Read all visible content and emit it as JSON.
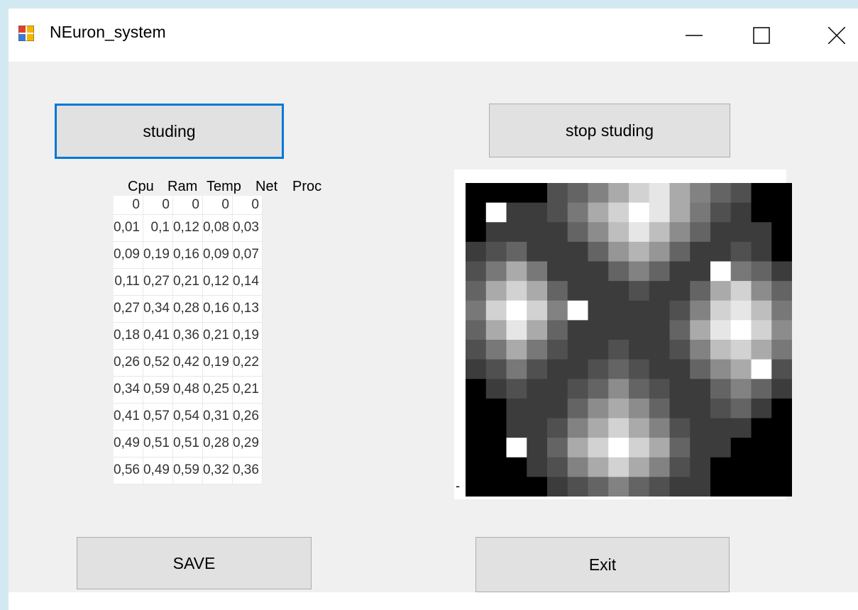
{
  "window": {
    "title": "NEuron_system",
    "controls": {
      "minimize": "minimize-icon",
      "maximize": "maximize-icon",
      "close": "close-icon"
    }
  },
  "buttons": {
    "studing": "studing",
    "stop_studing": "stop studing",
    "save": "SAVE",
    "exit": "Exit"
  },
  "grid": {
    "columns": [
      "Cpu",
      "Ram",
      "Temp",
      "Net",
      "Proc"
    ],
    "rows": [
      [
        "0",
        "0",
        "0",
        "0",
        "0"
      ],
      [
        "0,01",
        "0,1",
        "0,12",
        "0,08",
        "0,03"
      ],
      [
        "0,09",
        "0,19",
        "0,16",
        "0,09",
        "0,07"
      ],
      [
        "0,11",
        "0,27",
        "0,21",
        "0,12",
        "0,14"
      ],
      [
        "0,27",
        "0,34",
        "0,28",
        "0,16",
        "0,13"
      ],
      [
        "0,18",
        "0,41",
        "0,36",
        "0,21",
        "0,19"
      ],
      [
        "0,26",
        "0,52",
        "0,42",
        "0,19",
        "0,22"
      ],
      [
        "0,34",
        "0,59",
        "0,48",
        "0,25",
        "0,21"
      ],
      [
        "0,41",
        "0,57",
        "0,54",
        "0,31",
        "0,26"
      ],
      [
        "0,49",
        "0,51",
        "0,51",
        "0,28",
        "0,29"
      ],
      [
        "0,56",
        "0,49",
        "0,59",
        "0,32",
        "0,36"
      ]
    ]
  },
  "image_panel": {
    "side_mark": "-",
    "grid_size": 16,
    "cells": [
      [
        0,
        0,
        0,
        0,
        80,
        100,
        130,
        170,
        210,
        230,
        170,
        130,
        100,
        80,
        0,
        0
      ],
      [
        0,
        255,
        60,
        60,
        80,
        120,
        170,
        210,
        255,
        230,
        170,
        120,
        80,
        60,
        0,
        0
      ],
      [
        0,
        60,
        60,
        60,
        60,
        100,
        140,
        190,
        230,
        190,
        140,
        100,
        60,
        60,
        60,
        0
      ],
      [
        60,
        80,
        100,
        60,
        60,
        60,
        100,
        150,
        180,
        150,
        100,
        60,
        60,
        80,
        60,
        0
      ],
      [
        80,
        120,
        170,
        120,
        60,
        60,
        60,
        100,
        130,
        100,
        60,
        60,
        255,
        120,
        100,
        60
      ],
      [
        100,
        170,
        210,
        170,
        100,
        60,
        60,
        60,
        80,
        60,
        60,
        100,
        170,
        210,
        140,
        100
      ],
      [
        120,
        210,
        255,
        210,
        130,
        255,
        60,
        60,
        60,
        60,
        80,
        130,
        210,
        230,
        190,
        120
      ],
      [
        100,
        170,
        230,
        170,
        100,
        60,
        60,
        60,
        60,
        60,
        100,
        170,
        230,
        255,
        210,
        140
      ],
      [
        80,
        120,
        170,
        120,
        80,
        60,
        60,
        80,
        60,
        60,
        80,
        130,
        190,
        210,
        170,
        120
      ],
      [
        60,
        80,
        120,
        80,
        60,
        60,
        80,
        100,
        80,
        60,
        60,
        100,
        140,
        170,
        255,
        80
      ],
      [
        0,
        60,
        80,
        60,
        60,
        80,
        100,
        140,
        100,
        80,
        60,
        60,
        100,
        130,
        100,
        60
      ],
      [
        0,
        0,
        60,
        60,
        60,
        100,
        140,
        170,
        140,
        100,
        60,
        60,
        80,
        100,
        60,
        0
      ],
      [
        0,
        0,
        60,
        60,
        80,
        130,
        170,
        210,
        170,
        130,
        80,
        60,
        60,
        60,
        0,
        0
      ],
      [
        0,
        0,
        255,
        60,
        100,
        170,
        210,
        255,
        210,
        170,
        100,
        60,
        60,
        0,
        0,
        0
      ],
      [
        0,
        0,
        0,
        60,
        80,
        130,
        170,
        210,
        170,
        130,
        80,
        60,
        0,
        0,
        0,
        0
      ],
      [
        0,
        0,
        0,
        0,
        60,
        80,
        100,
        130,
        100,
        80,
        60,
        60,
        0,
        0,
        0,
        0
      ]
    ]
  }
}
